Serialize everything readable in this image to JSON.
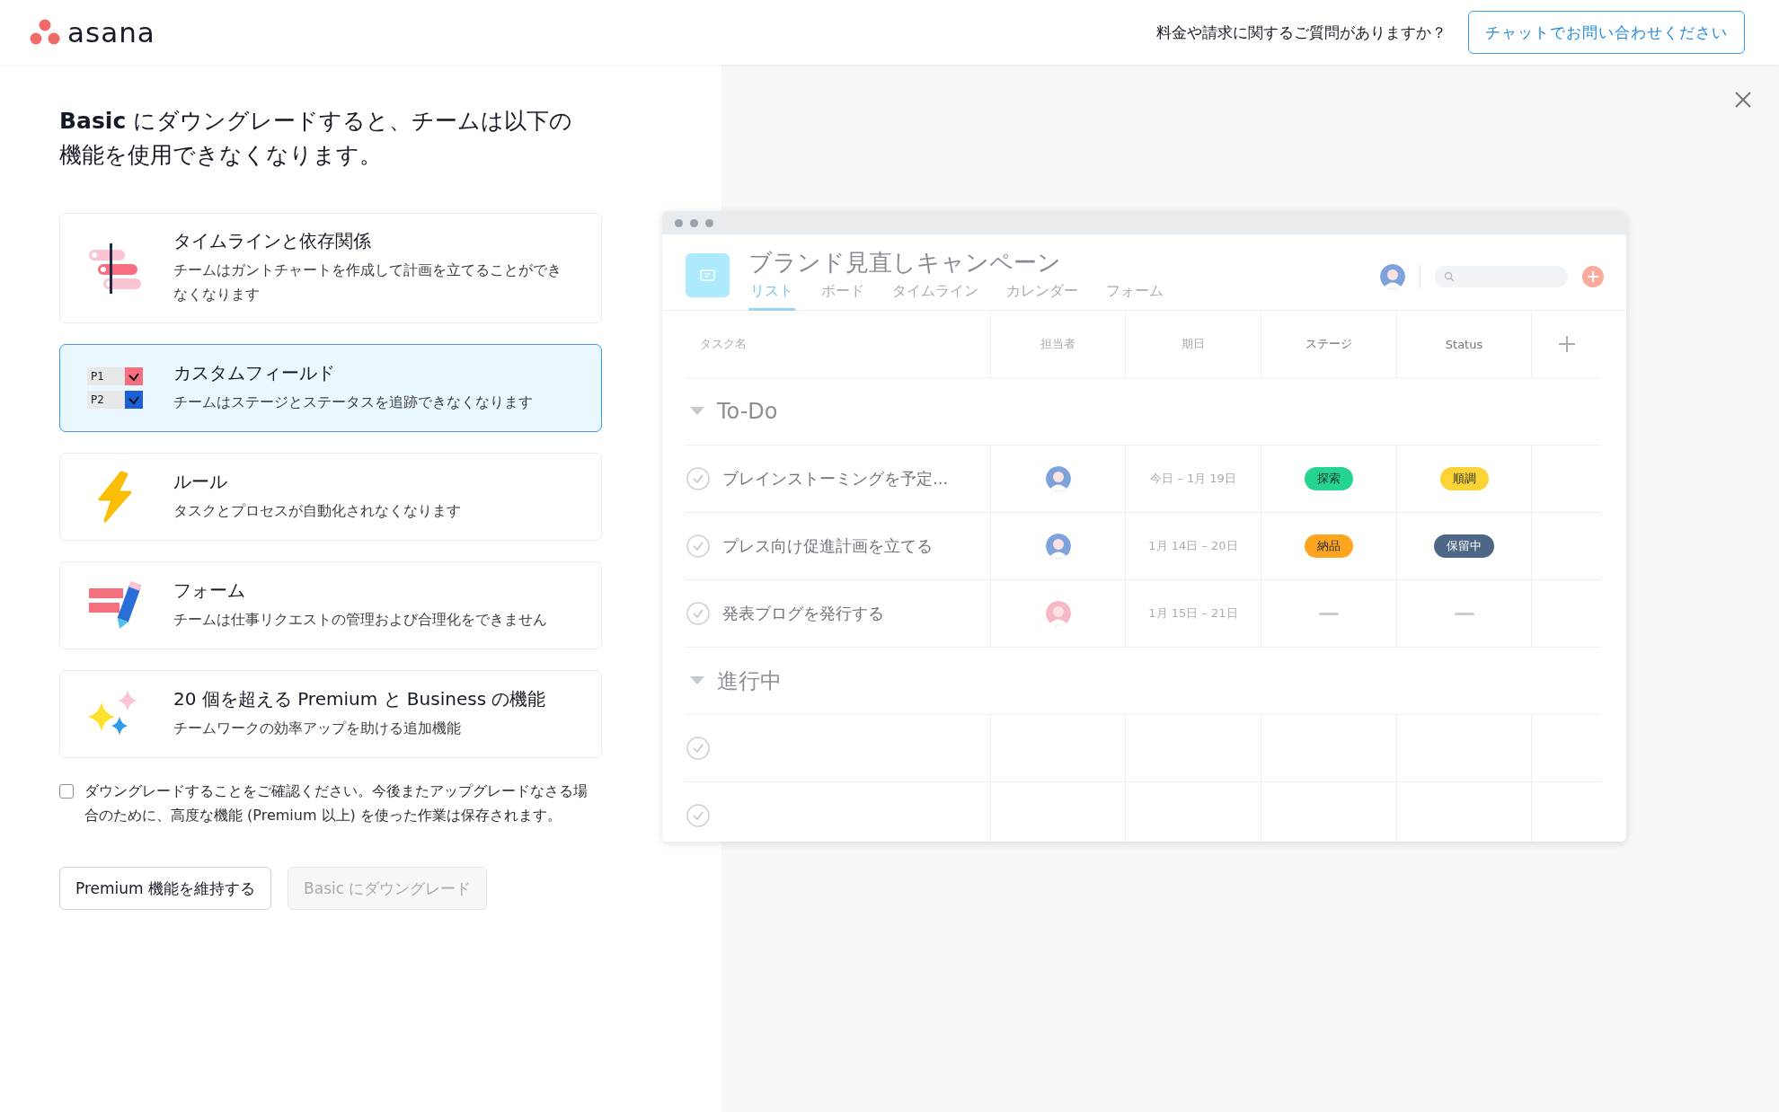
{
  "header": {
    "logo_text": "asana",
    "question": "料金や請求に関するご質問がありますか？",
    "chat_button": "チャットでお問い合わせください"
  },
  "heading": "**Basic** にダウングレードすると、チームは以下の機能を使用できなくなります。",
  "features": [
    {
      "kind": "timeline",
      "title": "タイムラインと依存関係",
      "description": "チームはガントチャートを作成して計画を立てることができなくなります",
      "selected": false
    },
    {
      "kind": "fields",
      "icon_labels": [
        "P1",
        "P2"
      ],
      "title": "カスタムフィールド",
      "description": "チームはステージとステータスを追跡できなくなります",
      "selected": true
    },
    {
      "kind": "rules",
      "title": "ルール",
      "description": "タスクとプロセスが自動化されなくなります",
      "selected": false
    },
    {
      "kind": "forms",
      "title": "フォーム",
      "description": "チームは仕事リクエストの管理および合理化をできません",
      "selected": false
    },
    {
      "kind": "sparkles",
      "title": "20 個を超える Premium と Business の機能",
      "description": "チームワークの効率アップを助ける追加機能",
      "selected": false
    }
  ],
  "confirm": {
    "checked": false,
    "text": "ダウングレードすることをご確認ください。今後またアップグレードなさる場合のために、高度な機能 (Premium 以上) を使った作業は保存されます。"
  },
  "buttons": [
    {
      "label": "Premium 機能を維持する",
      "disabled": false
    },
    {
      "label": "Basic にダウングレード",
      "disabled": true
    }
  ],
  "preview": {
    "project_title": "ブランド見直しキャンペーン",
    "tabs": [
      {
        "label": "リスト",
        "selected": true
      },
      {
        "label": "ボード",
        "selected": false
      },
      {
        "label": "タイムライン",
        "selected": false
      },
      {
        "label": "カレンダー",
        "selected": false
      },
      {
        "label": "フォーム",
        "selected": false
      }
    ],
    "columns": [
      "タスク名",
      "担当者",
      "期日",
      "ステージ",
      "Status"
    ],
    "sections": [
      {
        "name": "To-Do",
        "expanded": true,
        "tasks": [
          {
            "name": "ブレインストーミングを予定...",
            "completed": false,
            "assignee": {
              "color": "#7ea3dc"
            },
            "due": "今日 – 1月 19日",
            "stage": {
              "text": "探索",
              "color": "#25d48f"
            },
            "status": {
              "text": "順調",
              "color": "#fcd335"
            }
          },
          {
            "name": "プレス向け促進計画を立てる",
            "completed": false,
            "assignee": {
              "color": "#7ea3dc"
            },
            "due": "1月 14日 – 20日",
            "stage": {
              "text": "納品",
              "color": "#fda520"
            },
            "status": {
              "text": "保留中",
              "color": "#4f6786"
            }
          },
          {
            "name": "発表ブログを発行する",
            "completed": false,
            "assignee": {
              "color": "#f6b8c4"
            },
            "due": "1月 15日 – 21日"
          }
        ]
      },
      {
        "name": "進行中",
        "expanded": true,
        "tasks": [
          {
            "completed": false
          },
          {
            "completed": false
          }
        ]
      }
    ]
  }
}
